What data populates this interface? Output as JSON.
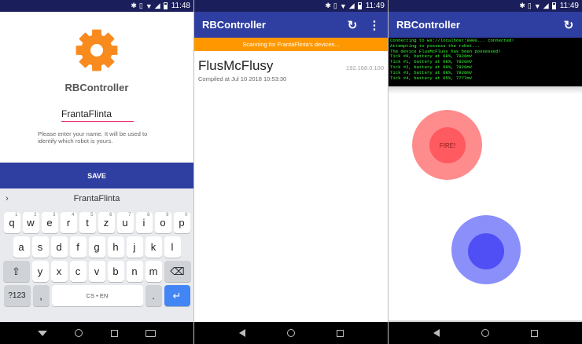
{
  "status_bars": [
    {
      "time": "11:48",
      "theme": "dark"
    },
    {
      "time": "11:49",
      "theme": "dark"
    },
    {
      "time": "11:49",
      "theme": "light"
    }
  ],
  "setup_screen": {
    "app_name": "RBController",
    "name_value": "FrantaFlinta",
    "hint": "Please enter your name. It will be used to identify which robot is yours.",
    "save_label": "SAVE",
    "gear_color": "#f98a1d"
  },
  "keyboard": {
    "suggestion": "FrantaFlinta",
    "row1": [
      {
        "key": "q",
        "sup": "1"
      },
      {
        "key": "w",
        "sup": "2"
      },
      {
        "key": "e",
        "sup": "3"
      },
      {
        "key": "r",
        "sup": "4"
      },
      {
        "key": "t",
        "sup": "5"
      },
      {
        "key": "z",
        "sup": "6"
      },
      {
        "key": "u",
        "sup": "7"
      },
      {
        "key": "i",
        "sup": "8"
      },
      {
        "key": "o",
        "sup": "9"
      },
      {
        "key": "p",
        "sup": "0"
      }
    ],
    "row2": [
      "a",
      "s",
      "d",
      "f",
      "g",
      "h",
      "j",
      "k",
      "l"
    ],
    "row3": [
      "y",
      "x",
      "c",
      "v",
      "b",
      "n",
      "m"
    ],
    "symbols_label": "?123",
    "comma_label": ",",
    "space_label": "CS • EN",
    "period_label": ".",
    "shift_icon": "shift-icon",
    "backspace_icon": "backspace-icon",
    "enter_icon": "enter-arrow-icon",
    "enter_color": "#4285f4"
  },
  "robot_list_screen": {
    "title": "RBController",
    "scan_banner": "Scanning for FrantaFlinta's devices...",
    "banner_color": "#ff9800",
    "robot": {
      "name": "FlusMcFlusy",
      "ip": "192.168.0.100",
      "compiled": "Compiled at Jul 10 2018 10:53:30"
    }
  },
  "controller_screen": {
    "title": "RBController",
    "log": [
      "Connecting to ws://localhost:9000... connected!",
      "Attempting to possess the robot...",
      "The device FlusMcFlusy has been possessed!",
      "Tick #0, battery at 68%, 7826mV",
      "Tick #1, battery at 68%, 7826mV",
      "Tick #2, battery at 68%, 7826mV",
      "Tick #3, battery at 68%, 7826mV",
      "Tick #4, battery at 65%, 7777mV"
    ],
    "fire_label": "FIRE!",
    "fire_color": "#ff5a5f",
    "move_color": "#4f4ff5"
  },
  "colors": {
    "primary": "#2f3ea1",
    "statusbar": "#1a1e5a",
    "field_underline": "#e91e63"
  }
}
